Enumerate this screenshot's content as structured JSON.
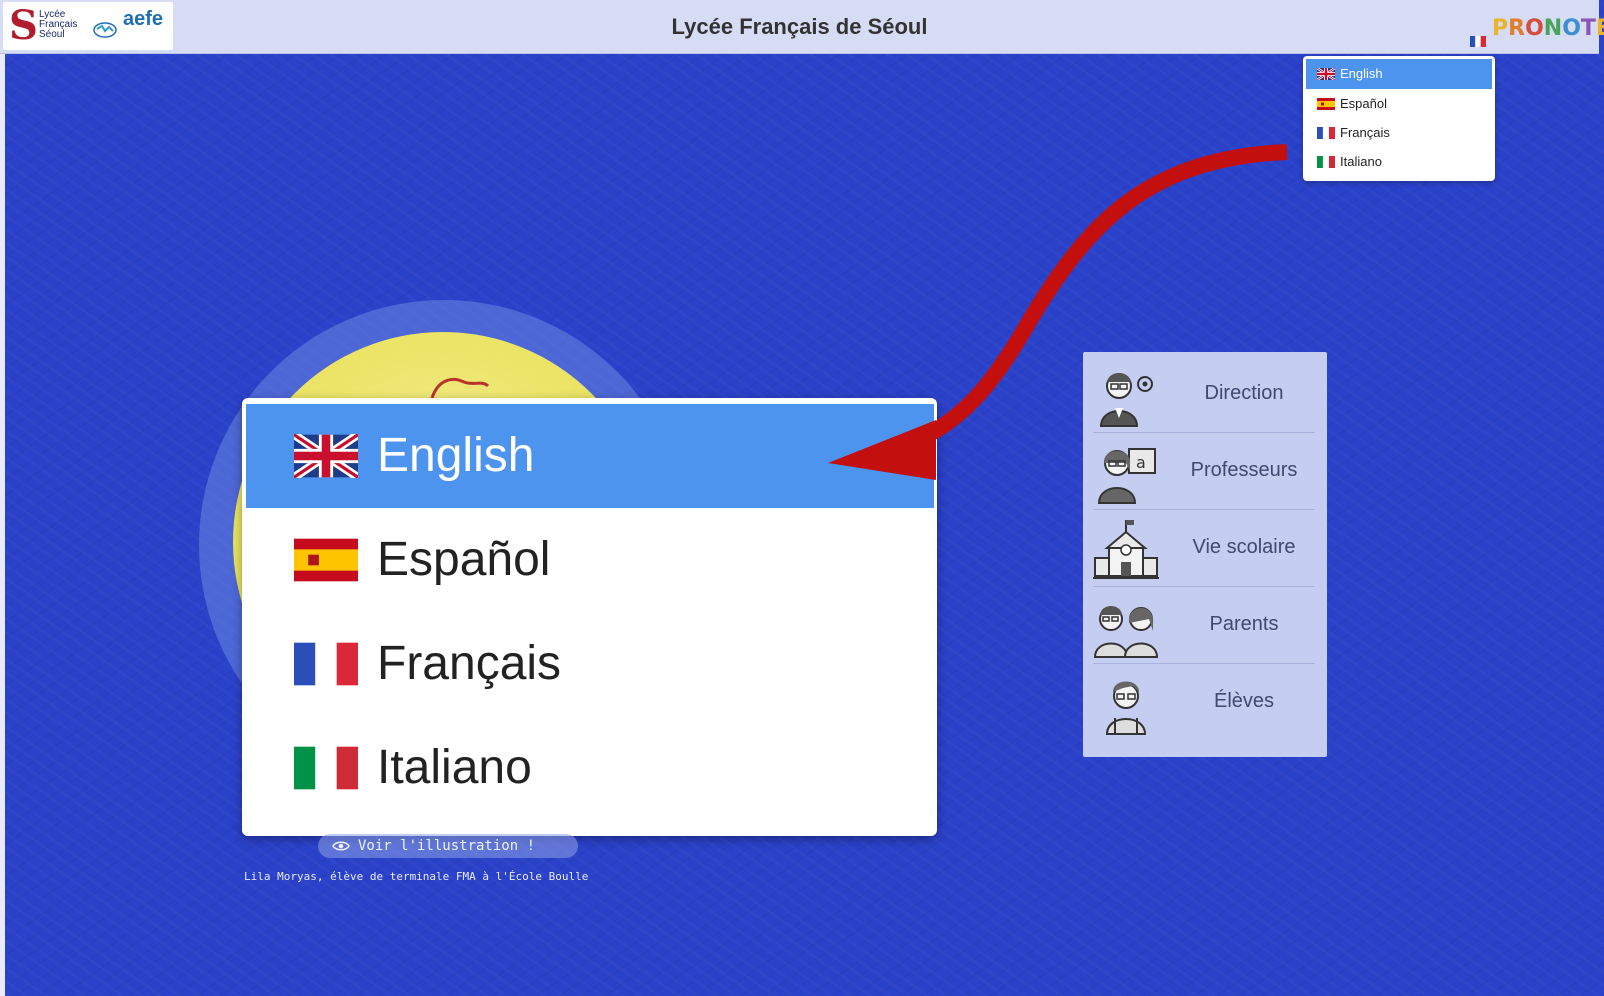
{
  "header": {
    "title": "Lycée Français de Séoul",
    "logo_lines": [
      "Lycée",
      "Français",
      "Séoul"
    ],
    "aefe": "aefe",
    "brand": "PRONOTE"
  },
  "languages": {
    "selected": "English",
    "options": [
      {
        "label": "English",
        "flag": "uk-flag"
      },
      {
        "label": "Español",
        "flag": "spain-flag"
      },
      {
        "label": "Français",
        "flag": "france-flag"
      },
      {
        "label": "Italiano",
        "flag": "italy-flag"
      }
    ]
  },
  "illustration": {
    "button_label": "Voir l'illustration !",
    "credit": "Lila Moryas, élève de terminale FMA à l'École Boulle"
  },
  "roles": [
    {
      "label": "Direction",
      "icon": "director-icon"
    },
    {
      "label": "Professeurs",
      "icon": "teacher-icon"
    },
    {
      "label": "Vie scolaire",
      "icon": "school-building-icon"
    },
    {
      "label": "Parents",
      "icon": "parents-icon"
    },
    {
      "label": "Élèves",
      "icon": "student-icon"
    }
  ],
  "colors": {
    "background": "#2a41c9",
    "header": "#d6dcf4",
    "selected": "#4d94ef",
    "arrow": "#c40f0f"
  }
}
